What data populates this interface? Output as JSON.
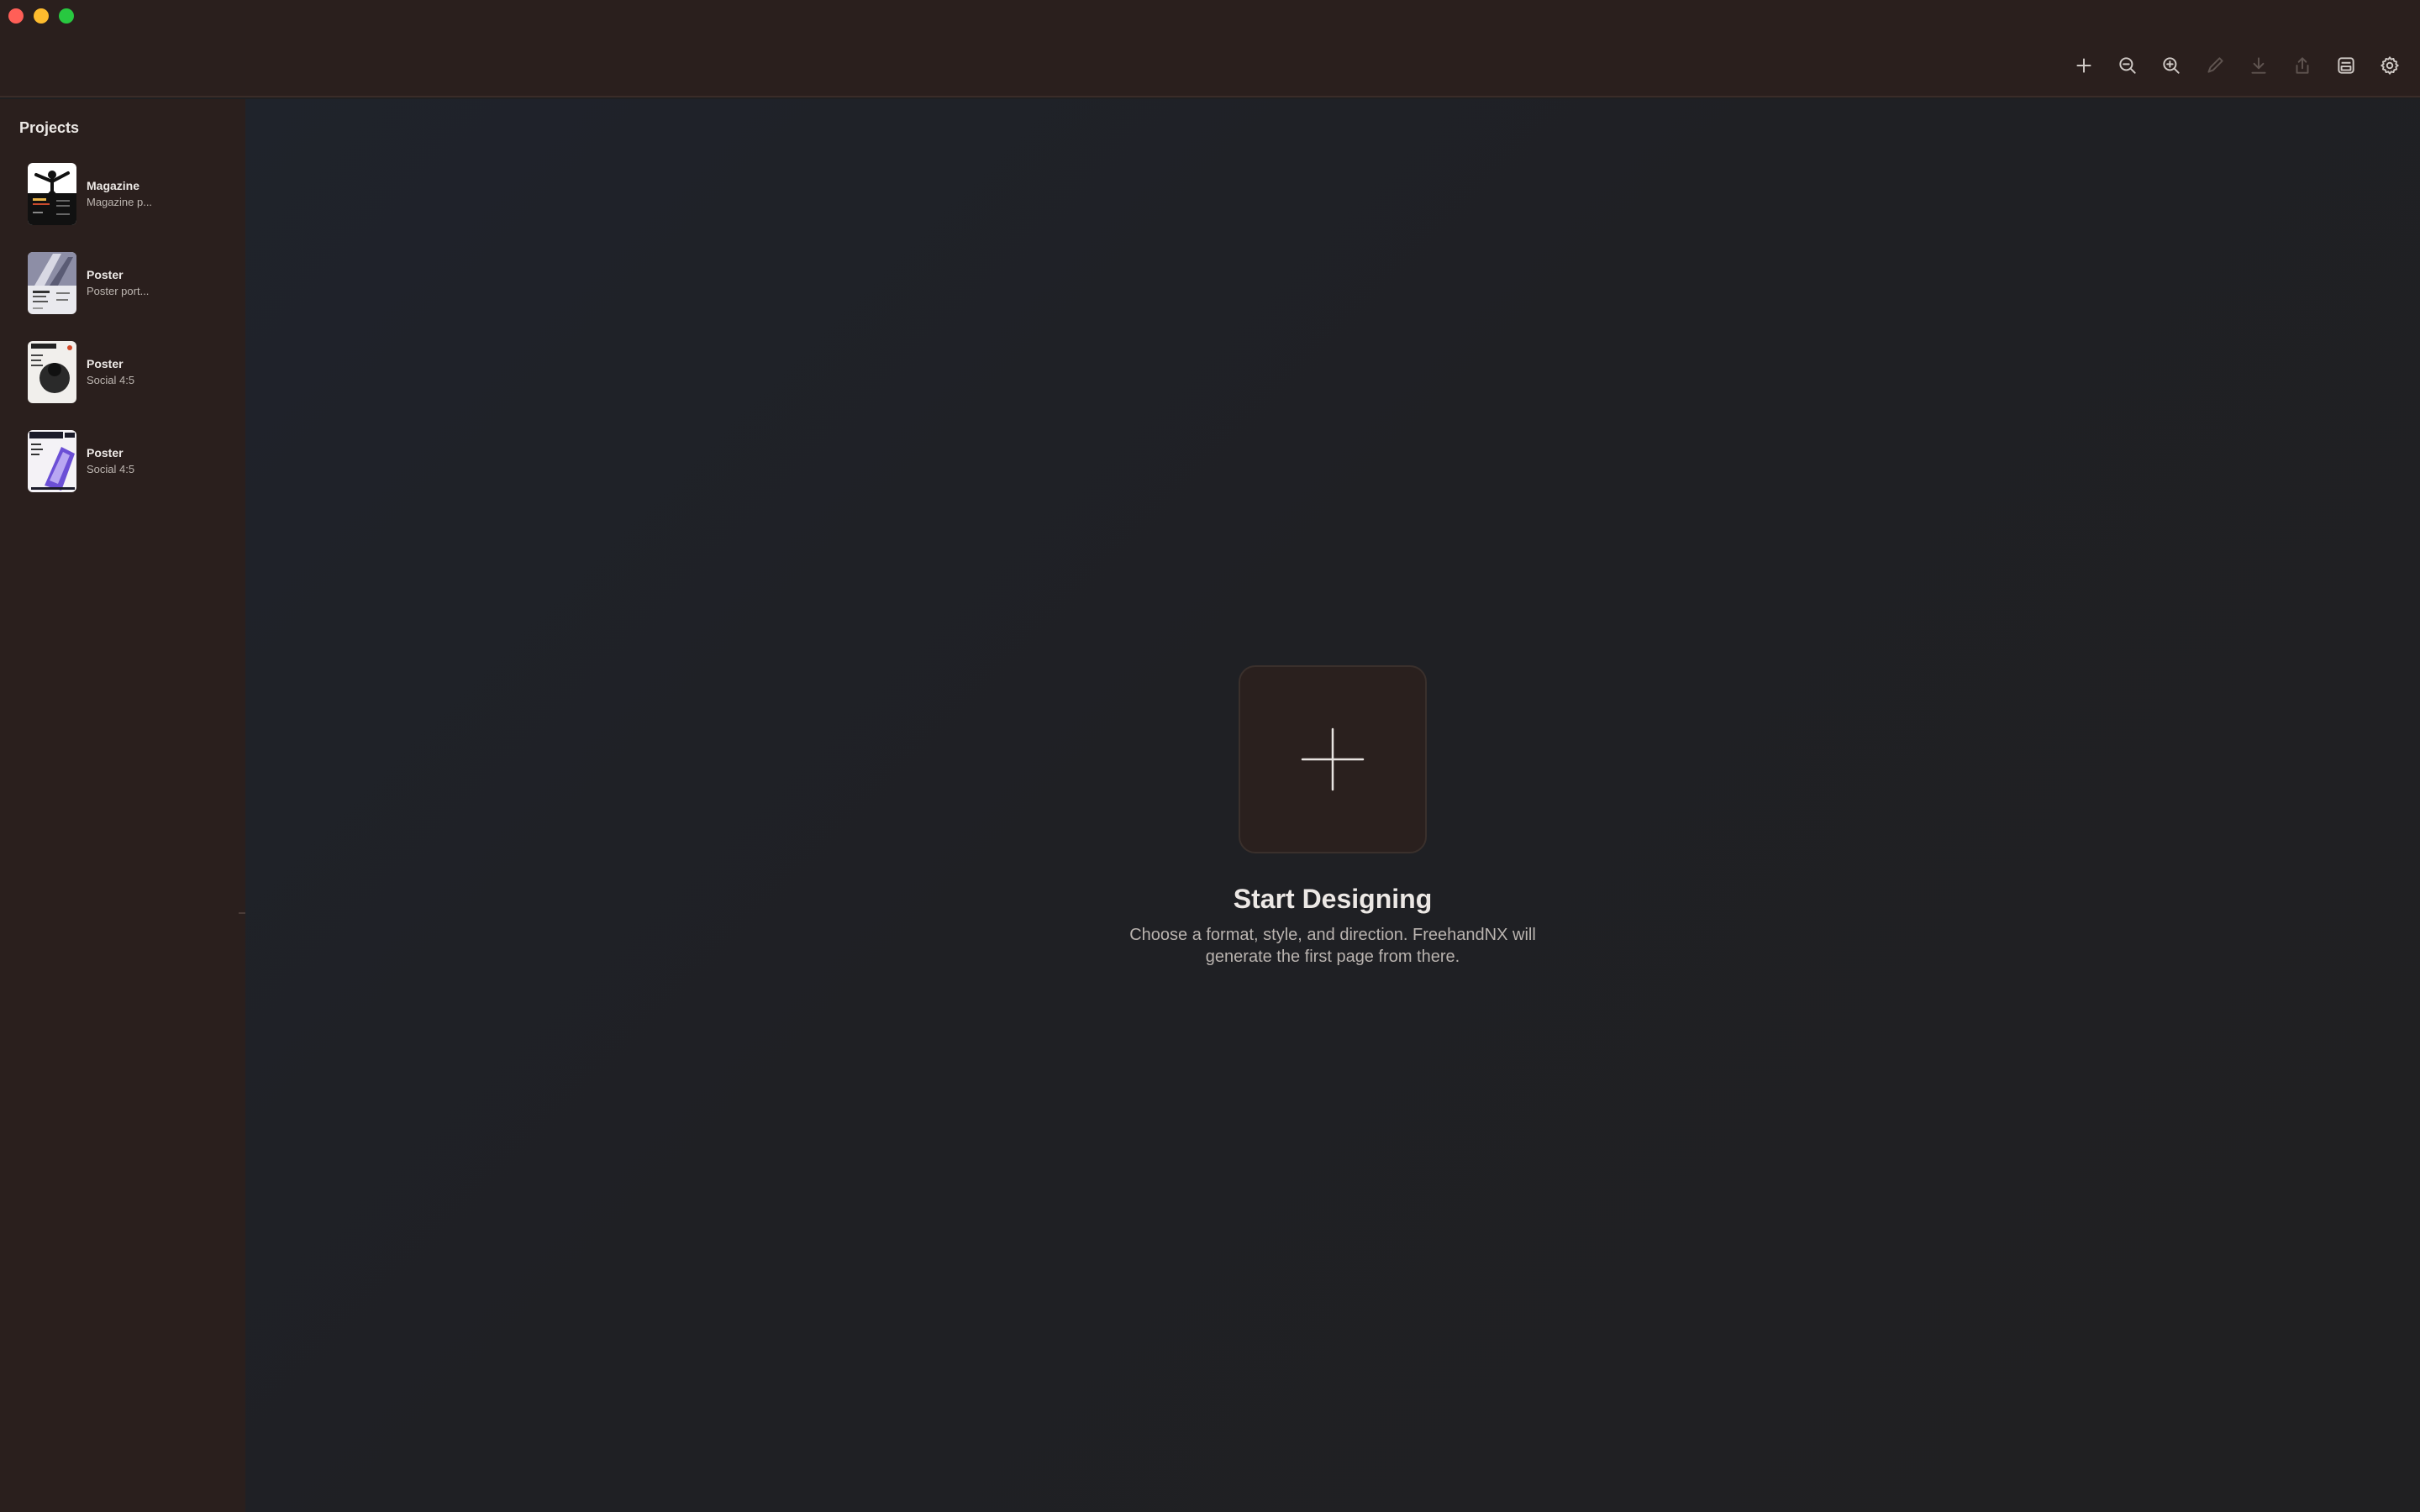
{
  "window": {
    "traffic_lights": [
      "close",
      "minimize",
      "zoom"
    ]
  },
  "toolbar": {
    "buttons": [
      {
        "icon": "plus-icon",
        "enabled": true
      },
      {
        "icon": "zoom-out-icon",
        "enabled": true
      },
      {
        "icon": "zoom-in-icon",
        "enabled": true
      },
      {
        "icon": "pencil-icon",
        "enabled": false
      },
      {
        "icon": "download-icon",
        "enabled": false
      },
      {
        "icon": "share-icon",
        "enabled": false
      },
      {
        "icon": "print-icon",
        "enabled": true
      },
      {
        "icon": "gear-icon",
        "enabled": true
      }
    ]
  },
  "sidebar": {
    "title": "Projects",
    "projects": [
      {
        "name": "Magazine",
        "subtitle": "Magazine p..."
      },
      {
        "name": "Poster",
        "subtitle": "Poster port..."
      },
      {
        "name": "Poster",
        "subtitle": "Social 4:5"
      },
      {
        "name": "Poster",
        "subtitle": "Social 4:5"
      }
    ]
  },
  "main": {
    "empty_state": {
      "title": "Start Designing",
      "description": "Choose a format, style, and direction. FreehandNX will generate the first page from there."
    }
  },
  "colors": {
    "titlebar_bg": "#2a1f1d",
    "canvas_bg": "#1f2024",
    "close": "#ff5f57",
    "minimize": "#febc2e",
    "zoom": "#28c840"
  }
}
